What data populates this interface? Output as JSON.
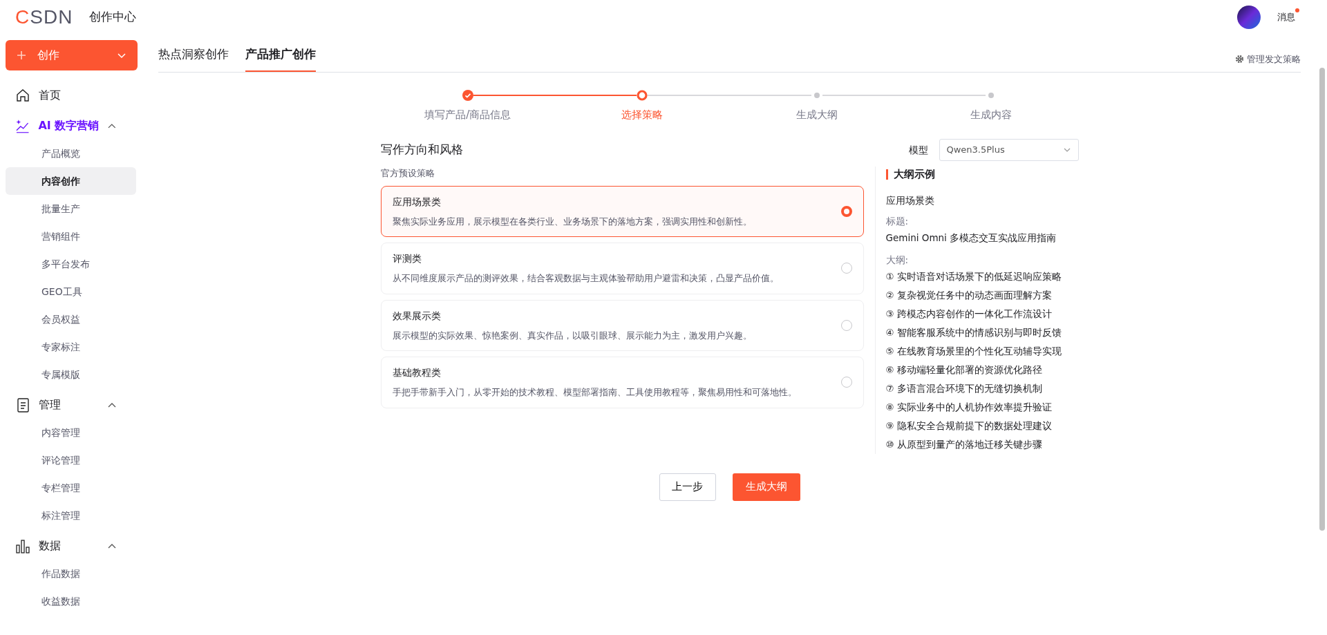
{
  "header": {
    "logo": "CSDN",
    "title": "创作中心",
    "messages": {
      "label": "消息",
      "unread": true
    }
  },
  "sidebar": {
    "create_button": "创作",
    "items": [
      {
        "kind": "link",
        "label": "首页",
        "selected": false
      },
      {
        "kind": "group",
        "label": "AI 数字营销",
        "highlighted": true,
        "expanded": true,
        "children": [
          {
            "label": "产品概览",
            "selected": false
          },
          {
            "label": "内容创作",
            "selected": true
          },
          {
            "label": "批量生产",
            "selected": false
          },
          {
            "label": "营销组件",
            "selected": false
          },
          {
            "label": "多平台发布",
            "selected": false
          },
          {
            "label": "GEO工具",
            "selected": false
          },
          {
            "label": "会员权益",
            "selected": false
          },
          {
            "label": "专家标注",
            "selected": false
          },
          {
            "label": "专属模版",
            "selected": false
          }
        ]
      },
      {
        "kind": "group",
        "label": "管理",
        "highlighted": false,
        "expanded": true,
        "children": [
          {
            "label": "内容管理",
            "selected": false
          },
          {
            "label": "评论管理",
            "selected": false
          },
          {
            "label": "专栏管理",
            "selected": false
          },
          {
            "label": "标注管理",
            "selected": false
          }
        ]
      },
      {
        "kind": "group",
        "label": "数据",
        "highlighted": false,
        "expanded": true,
        "children": [
          {
            "label": "作品数据",
            "selected": false
          },
          {
            "label": "收益数据",
            "selected": false
          }
        ]
      }
    ]
  },
  "tabs": [
    {
      "label": "热点洞察创作",
      "selected": false
    },
    {
      "label": "产品推广创作",
      "selected": true
    }
  ],
  "settings_link": "管理发文策略",
  "steps": [
    {
      "label": "填写产品/商品信息",
      "completed": true,
      "selected": false
    },
    {
      "label": "选择策略",
      "completed": false,
      "selected": true
    },
    {
      "label": "生成大纲",
      "completed": false,
      "selected": false
    },
    {
      "label": "生成内容",
      "completed": false,
      "selected": false
    }
  ],
  "section_title": "写作方向和风格",
  "model": {
    "label": "模型",
    "value": "Qwen3.5Plus"
  },
  "preset_label": "官方预设策略",
  "strategies": [
    {
      "title": "应用场景类",
      "description": "聚焦实际业务应用，展示模型在各类行业、业务场景下的落地方案，强调实用性和创新性。",
      "selected": true
    },
    {
      "title": "评测类",
      "description": "从不同维度展示产品的测评效果，结合客观数据与主观体验帮助用户避雷和决策，凸显产品价值。",
      "selected": false
    },
    {
      "title": "效果展示类",
      "description": "展示模型的实际效果、惊艳案例、真实作品，以吸引眼球、展示能力为主，激发用户兴趣。",
      "selected": false
    },
    {
      "title": "基础教程类",
      "description": "手把手带新手入门，从零开始的技术教程、模型部署指南、工具使用教程等，聚焦易用性和可落地性。",
      "selected": false
    }
  ],
  "outline_example": {
    "heading": "大纲示例",
    "category": "应用场景类",
    "title_label": "标题:",
    "title": "Gemini Omni 多模态交互实战应用指南",
    "outline_label": "大纲:",
    "items": [
      "① 实时语音对话场景下的低延迟响应策略",
      "② 复杂视觉任务中的动态画面理解方案",
      "③ 跨模态内容创作的一体化工作流设计",
      "④ 智能客服系统中的情感识别与即时反馈",
      "⑤ 在线教育场景里的个性化互动辅导实现",
      "⑥ 移动端轻量化部署的资源优化路径",
      "⑦ 多语言混合环境下的无缝切换机制",
      "⑧ 实际业务中的人机协作效率提升验证",
      "⑨ 隐私安全合规前提下的数据处理建议",
      "⑩ 从原型到量产的落地迁移关键步骤"
    ]
  },
  "buttons": {
    "back": "上一步",
    "next": "生成大纲"
  }
}
